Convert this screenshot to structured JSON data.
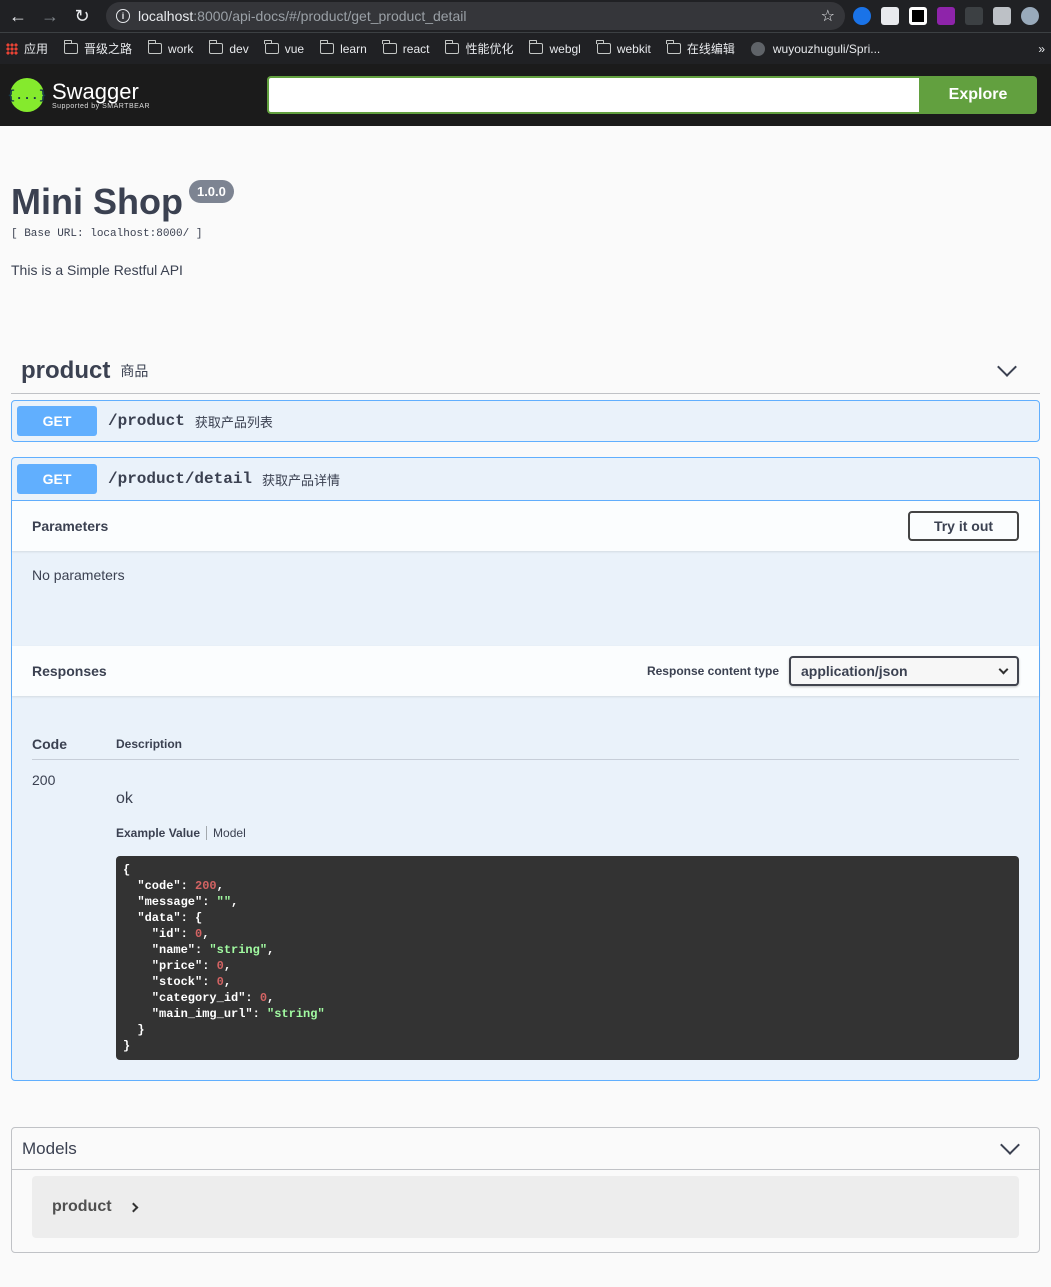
{
  "browser": {
    "url_host": "localhost",
    "url_path": ":8000/api-docs/#/product/get_product_detail",
    "bookmarks": [
      "应用",
      "晋级之路",
      "work",
      "dev",
      "vue",
      "learn",
      "react",
      "性能优化",
      "webgl",
      "webkit",
      "在线编辑",
      "wuyouzhuguli/Spri..."
    ],
    "more": "»"
  },
  "topbar": {
    "logo_glyph": "{...}",
    "logo_text": "Swagger",
    "logo_sub": "Supported by SMARTBEAR",
    "search_value": "",
    "explore_label": "Explore",
    "accent": "#62a03f"
  },
  "info": {
    "title": "Mini Shop",
    "version": "1.0.0",
    "base_url": "[ Base URL: localhost:8000/ ]",
    "description": "This is a Simple Restful API"
  },
  "tag": {
    "name": "product",
    "description": "商品"
  },
  "operations": [
    {
      "method": "GET",
      "path": "/product",
      "summary": "获取产品列表"
    },
    {
      "method": "GET",
      "path": "/product/detail",
      "summary": "获取产品详情"
    }
  ],
  "detail": {
    "parameters_title": "Parameters",
    "try_label": "Try it out",
    "no_params": "No parameters",
    "responses_title": "Responses",
    "content_type_label": "Response content type",
    "content_type_value": "application/json",
    "col_code": "Code",
    "col_description": "Description",
    "response_code": "200",
    "response_desc": "ok",
    "tab_example": "Example Value",
    "tab_model": "Model"
  },
  "example_json": [
    {
      "t": "{"
    },
    {
      "t": "  \"code\": ",
      "v": "200",
      "vt": "num",
      "e": ","
    },
    {
      "t": "  \"message\": ",
      "v": "\"\"",
      "vt": "str",
      "e": ","
    },
    {
      "t": "  \"data\": {"
    },
    {
      "t": "    \"id\": ",
      "v": "0",
      "vt": "num",
      "e": ","
    },
    {
      "t": "    \"name\": ",
      "v": "\"string\"",
      "vt": "str",
      "e": ","
    },
    {
      "t": "    \"price\": ",
      "v": "0",
      "vt": "num",
      "e": ","
    },
    {
      "t": "    \"stock\": ",
      "v": "0",
      "vt": "num",
      "e": ","
    },
    {
      "t": "    \"category_id\": ",
      "v": "0",
      "vt": "num",
      "e": ","
    },
    {
      "t": "    \"main_img_url\": ",
      "v": "\"string\"",
      "vt": "str",
      "e": ""
    },
    {
      "t": "  }"
    },
    {
      "t": "}"
    }
  ],
  "models": {
    "title": "Models",
    "items": [
      "product"
    ]
  }
}
